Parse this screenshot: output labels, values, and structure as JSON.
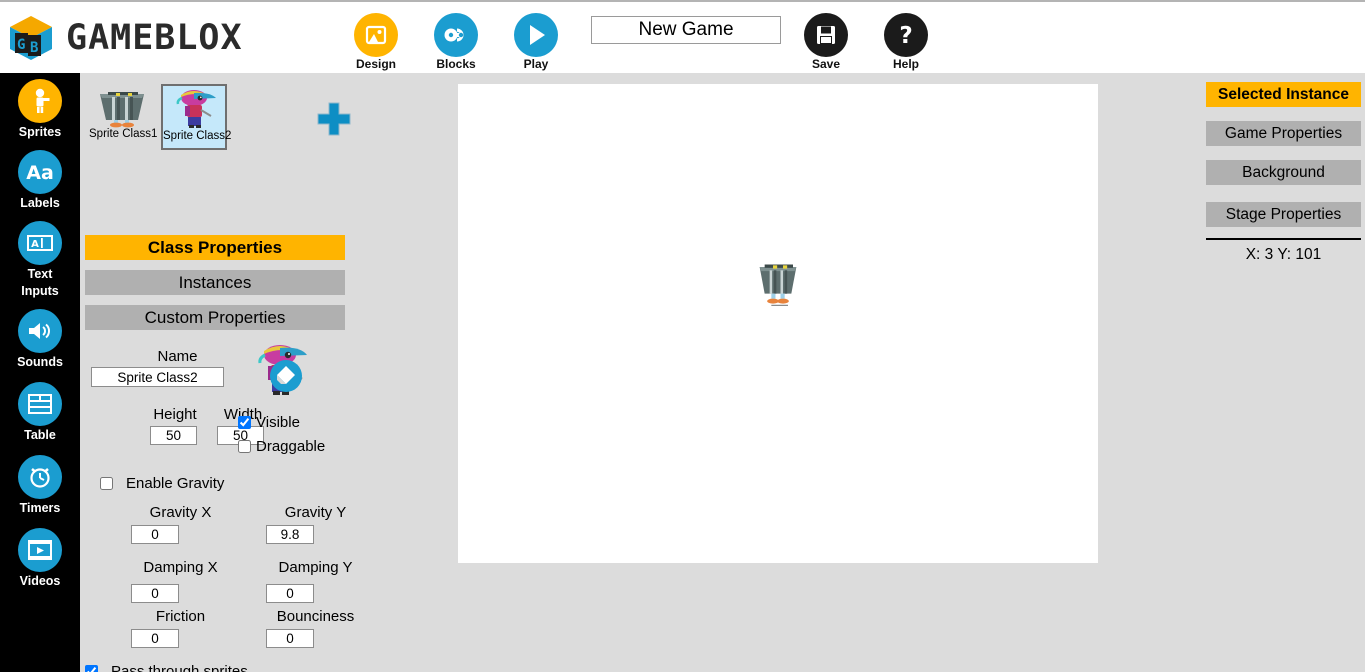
{
  "header": {
    "brand": "GAMEBLOX",
    "tools": [
      {
        "label": "Design",
        "icon": "image-design-icon",
        "color": "#ffb400"
      },
      {
        "label": "Blocks",
        "icon": "blocks-icon",
        "color": "#1b9dd0"
      },
      {
        "label": "Play",
        "icon": "play-icon",
        "color": "#1b9dd0"
      },
      {
        "label": "Save",
        "icon": "save-floppy-icon",
        "color": "#1b1b1b"
      },
      {
        "label": "Help",
        "icon": "question-mark-icon",
        "color": "#1b1b1b"
      }
    ],
    "game_title": "New Game"
  },
  "sidebar": {
    "items": [
      {
        "label": "Sprites",
        "icon": "sprite-person-icon",
        "color": "#ffb400",
        "active": true
      },
      {
        "label": "Labels",
        "icon": "labels-aa-icon",
        "color": "#1b9dd0",
        "active": false
      },
      {
        "label": "Text\nInputs",
        "label_line1": "Text",
        "label_line2": "Inputs",
        "icon": "text-input-icon",
        "color": "#1b9dd0",
        "active": false
      },
      {
        "label": "Sounds",
        "icon": "speaker-icon",
        "color": "#1b9dd0",
        "active": false
      },
      {
        "label": "Table",
        "icon": "table-grid-icon",
        "color": "#1b9dd0",
        "active": false
      },
      {
        "label": "Timers",
        "icon": "alarm-clock-icon",
        "color": "#1b9dd0",
        "active": false
      },
      {
        "label": "Videos",
        "icon": "film-play-icon",
        "color": "#1b9dd0",
        "active": false
      }
    ]
  },
  "sprite_list": {
    "add_label": "+",
    "items": [
      {
        "name": "Sprite Class1",
        "sprite": "trashcan",
        "selected": false
      },
      {
        "name": "Sprite Class2",
        "sprite": "character",
        "selected": true
      }
    ]
  },
  "class_panel": {
    "tabs": [
      {
        "label": "Class Properties",
        "active": true
      },
      {
        "label": "Instances",
        "active": false
      },
      {
        "label": "Custom Properties",
        "active": false
      }
    ],
    "name_label": "Name",
    "name_value": "Sprite Class2",
    "edit_icon": "pencil-edit-icon",
    "height_label": "Height",
    "height_value": "50",
    "width_label": "Width",
    "width_value": "50",
    "visible_label": "Visible",
    "visible_checked": true,
    "draggable_label": "Draggable",
    "draggable_checked": false,
    "enable_gravity_label": "Enable Gravity",
    "enable_gravity_checked": false,
    "gravity_x_label": "Gravity X",
    "gravity_x_value": "0",
    "gravity_y_label": "Gravity Y",
    "gravity_y_value": "9.8",
    "damping_x_label": "Damping X",
    "damping_x_value": "0",
    "damping_y_label": "Damping Y",
    "damping_y_value": "0",
    "friction_label": "Friction",
    "friction_value": "0",
    "bounciness_label": "Bounciness",
    "bounciness_value": "0",
    "pass_through_label": "Pass through sprites",
    "pass_through_checked": true
  },
  "stage": {
    "sprite_on_stage": "trashcan"
  },
  "right_panel": {
    "tabs": [
      {
        "label": "Selected Instance",
        "active": true
      },
      {
        "label": "Game Properties",
        "active": false
      },
      {
        "label": "Background",
        "active": false
      },
      {
        "label": "Stage Properties",
        "active": false
      }
    ],
    "coords": "X: 3   Y: 101"
  },
  "colors": {
    "accent_orange": "#ffb400",
    "accent_blue": "#1b9dd0",
    "panel_gray": "#dcdcdc",
    "tab_gray": "#b0b0b0",
    "nav_black": "#000000"
  }
}
